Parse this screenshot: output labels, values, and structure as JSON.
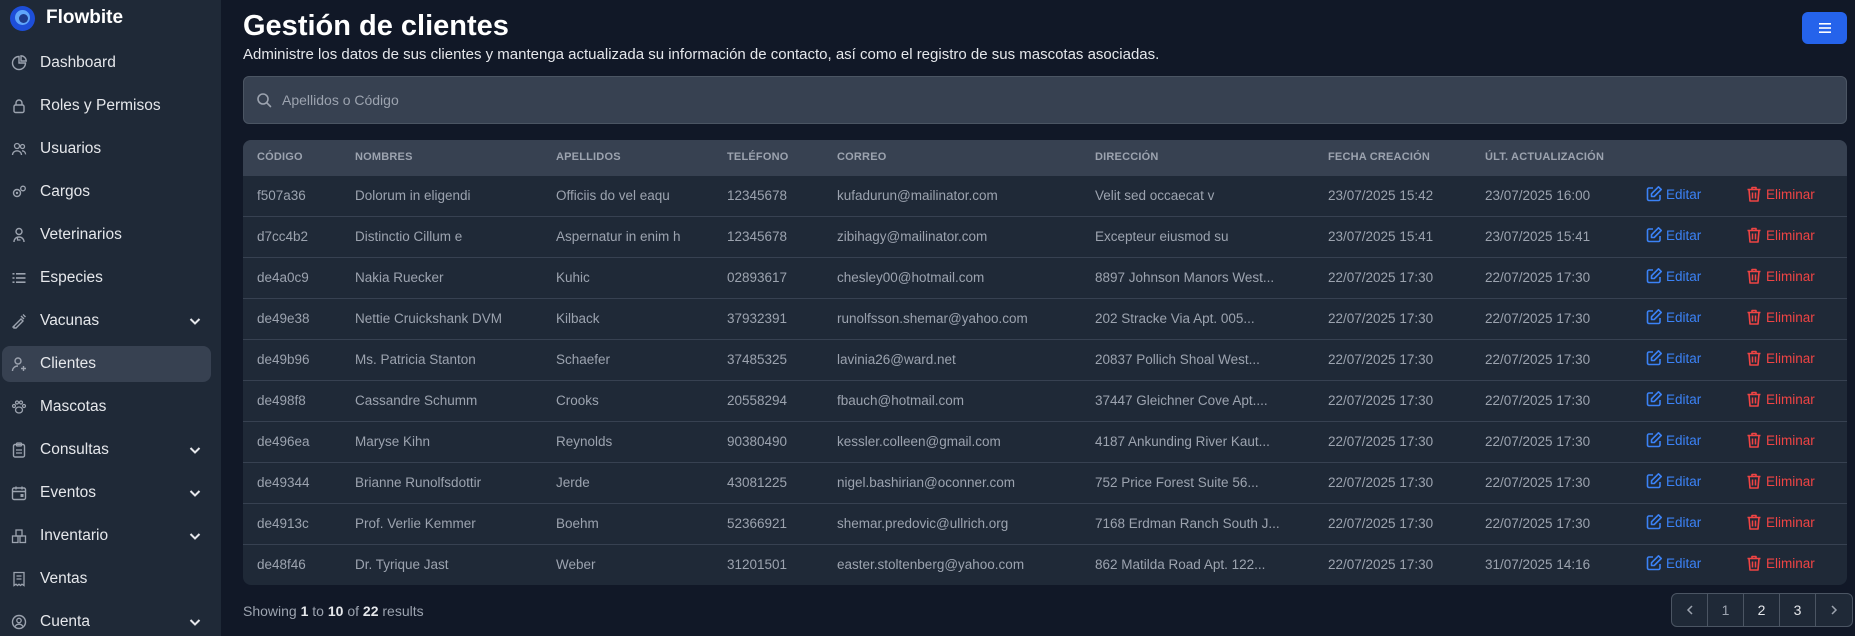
{
  "brand": {
    "name": "Flowbite"
  },
  "sidebar": {
    "items": [
      {
        "label": "Dashboard",
        "icon": "chart-pie-icon",
        "chevron": false,
        "active": false
      },
      {
        "label": "Roles y Permisos",
        "icon": "lock-icon",
        "chevron": false,
        "active": false
      },
      {
        "label": "Usuarios",
        "icon": "users-icon",
        "chevron": false,
        "active": false
      },
      {
        "label": "Cargos",
        "icon": "cogs-icon",
        "chevron": false,
        "active": false
      },
      {
        "label": "Veterinarios",
        "icon": "user-doctor-icon",
        "chevron": false,
        "active": false
      },
      {
        "label": "Especies",
        "icon": "list-icon",
        "chevron": false,
        "active": false
      },
      {
        "label": "Vacunas",
        "icon": "syringe-icon",
        "chevron": true,
        "active": false
      },
      {
        "label": "Clientes",
        "icon": "user-icon",
        "chevron": false,
        "active": true
      },
      {
        "label": "Mascotas",
        "icon": "paw-icon",
        "chevron": false,
        "active": false
      },
      {
        "label": "Consultas",
        "icon": "clipboard-icon",
        "chevron": true,
        "active": false
      },
      {
        "label": "Eventos",
        "icon": "calendar-icon",
        "chevron": true,
        "active": false
      },
      {
        "label": "Inventario",
        "icon": "warehouse-icon",
        "chevron": true,
        "active": false
      },
      {
        "label": "Ventas",
        "icon": "receipt-icon",
        "chevron": false,
        "active": false
      },
      {
        "label": "Cuenta",
        "icon": "user-circle-icon",
        "chevron": true,
        "active": false
      }
    ]
  },
  "page": {
    "title": "Gestión de clientes",
    "subtitle": "Administre los datos de sus clientes y mantenga actualizada su información de contacto, así como el registro de sus mascotas asociadas."
  },
  "search": {
    "placeholder": "Apellidos o Código",
    "value": ""
  },
  "table": {
    "columns": [
      "CÓDIGO",
      "NOMBRES",
      "APELLIDOS",
      "TELÉFONO",
      "CORREO",
      "DIRECCIÓN",
      "FECHA CREACIÓN",
      "ÚLT. ACTUALIZACIÓN"
    ],
    "edit_label": "Editar",
    "delete_label": "Eliminar",
    "rows": [
      [
        "f507a36",
        "Dolorum in eligendi",
        "Officiis do vel eaqu",
        "12345678",
        "kufadurun@mailinator.com",
        "Velit sed occaecat v",
        "23/07/2025 15:42",
        "23/07/2025 16:00"
      ],
      [
        "d7cc4b2",
        "Distinctio Cillum e",
        "Aspernatur in enim h",
        "12345678",
        "zibihagy@mailinator.com",
        "Excepteur eiusmod su",
        "23/07/2025 15:41",
        "23/07/2025 15:41"
      ],
      [
        "de4a0c9",
        "Nakia Ruecker",
        "Kuhic",
        "02893617",
        "chesley00@hotmail.com",
        "8897 Johnson Manors West...",
        "22/07/2025 17:30",
        "22/07/2025 17:30"
      ],
      [
        "de49e38",
        "Nettie Cruickshank DVM",
        "Kilback",
        "37932391",
        "runolfsson.shemar@yahoo.com",
        "202 Stracke Via Apt. 005...",
        "22/07/2025 17:30",
        "22/07/2025 17:30"
      ],
      [
        "de49b96",
        "Ms. Patricia Stanton",
        "Schaefer",
        "37485325",
        "lavinia26@ward.net",
        "20837 Pollich Shoal West...",
        "22/07/2025 17:30",
        "22/07/2025 17:30"
      ],
      [
        "de498f8",
        "Cassandre Schumm",
        "Crooks",
        "20558294",
        "fbauch@hotmail.com",
        "37447 Gleichner Cove Apt....",
        "22/07/2025 17:30",
        "22/07/2025 17:30"
      ],
      [
        "de496ea",
        "Maryse Kihn",
        "Reynolds",
        "90380490",
        "kessler.colleen@gmail.com",
        "4187 Ankunding River Kaut...",
        "22/07/2025 17:30",
        "22/07/2025 17:30"
      ],
      [
        "de49344",
        "Brianne Runolfsdottir",
        "Jerde",
        "43081225",
        "nigel.bashirian@oconner.com",
        "752 Price Forest Suite 56...",
        "22/07/2025 17:30",
        "22/07/2025 17:30"
      ],
      [
        "de4913c",
        "Prof. Verlie Kemmer",
        "Boehm",
        "52366921",
        "shemar.predovic@ullrich.org",
        "7168 Erdman Ranch South J...",
        "22/07/2025 17:30",
        "22/07/2025 17:30"
      ],
      [
        "de48f46",
        "Dr. Tyrique Jast",
        "Weber",
        "31201501",
        "easter.stoltenberg@yahoo.com",
        "862 Matilda Road Apt. 122...",
        "22/07/2025 17:30",
        "31/07/2025 14:16"
      ]
    ]
  },
  "pagination": {
    "showing": "Showing",
    "from": "1",
    "to_word": "to",
    "to": "10",
    "of_word": "of",
    "total": "22",
    "results_word": "results",
    "pages": [
      "1",
      "2",
      "3"
    ],
    "current": "1"
  },
  "colors": {
    "accent": "#2563eb",
    "edit": "#3b82f6",
    "delete": "#ef4444",
    "background": "#111827",
    "sidebar": "#1f2937"
  }
}
